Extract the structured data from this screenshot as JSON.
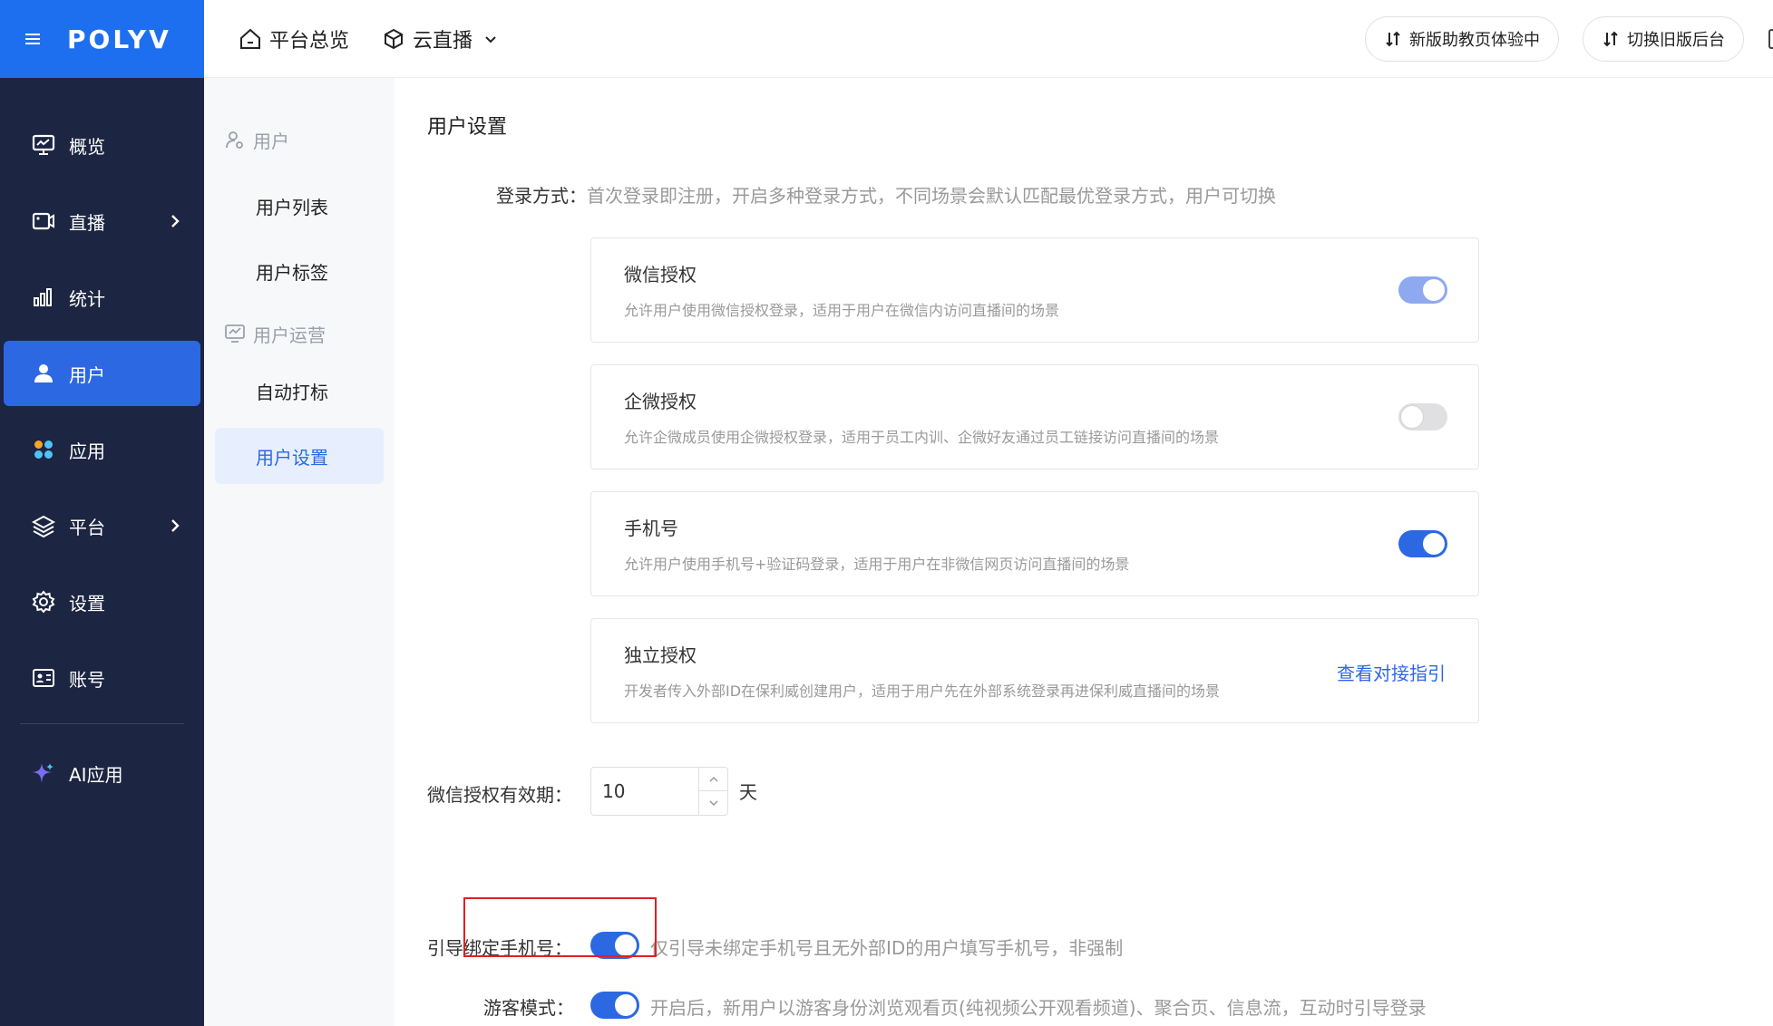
{
  "header": {
    "logo": "POLYV",
    "nav_overview": "平台总览",
    "nav_live": "云直播",
    "btn_new_assistant": "新版助教页体验中",
    "btn_switch_old": "切换旧版后台"
  },
  "sidebar": {
    "items": [
      {
        "label": "概览",
        "icon": "monitor-icon"
      },
      {
        "label": "直播",
        "icon": "video-icon"
      },
      {
        "label": "统计",
        "icon": "bar-chart-icon"
      },
      {
        "label": "用户",
        "icon": "user-icon"
      },
      {
        "label": "应用",
        "icon": "apps-icon"
      },
      {
        "label": "平台",
        "icon": "layers-icon"
      },
      {
        "label": "设置",
        "icon": "gear-icon"
      },
      {
        "label": "账号",
        "icon": "id-card-icon"
      },
      {
        "label": "AI应用",
        "icon": "sparkle-icon"
      }
    ]
  },
  "subnav": {
    "group_user": "用户",
    "item_user_list": "用户列表",
    "item_user_tags": "用户标签",
    "group_operation": "用户运营",
    "item_auto_tag": "自动打标",
    "item_user_settings": "用户设置"
  },
  "main": {
    "title": "用户设置",
    "login_label": "登录方式：",
    "login_desc": "首次登录即注册，开启多种登录方式，不同场景会默认匹配最优登录方式，用户可切换",
    "cards": [
      {
        "title": "微信授权",
        "desc": "允许用户使用微信授权登录，适用于用户在微信内访问直播间的场景",
        "state": "on-disabled"
      },
      {
        "title": "企微授权",
        "desc": "允许企微成员使用企微授权登录，适用于员工内训、企微好友通过员工链接访问直播间的场景",
        "state": "off"
      },
      {
        "title": "手机号",
        "desc": "允许用户使用手机号+验证码登录，适用于用户在非微信网页访问直播间的场景",
        "state": "on"
      },
      {
        "title": "独立授权",
        "desc": "开发者传入外部ID在保利威创建用户，适用于用户先在外部系统登录再进保利威直播间的场景",
        "link": "查看对接指引"
      }
    ],
    "wechat_validity_label": "微信授权有效期：",
    "wechat_validity_value": "10",
    "wechat_validity_unit": "天",
    "bind_phone_label": "引导绑定手机号：",
    "bind_phone_desc": "仅引导未绑定手机号且无外部ID的用户填写手机号，非强制",
    "guest_mode_label": "游客模式：",
    "guest_mode_desc": "开启后，新用户以游客身份浏览观看页(纯视频公开观看频道)、聚合页、信息流，互动时引导登录"
  },
  "colors": {
    "accent": "#2d68e3",
    "sidebar_bg": "#1c2541",
    "highlight": "#e02020"
  }
}
